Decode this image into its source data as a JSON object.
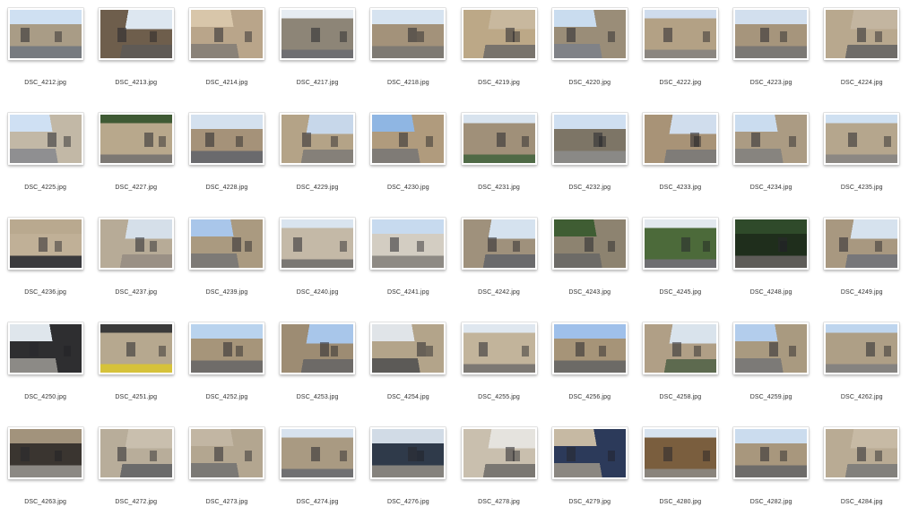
{
  "files": [
    {
      "name": "DSC_4212.jpg",
      "sky": "#cfe0f2",
      "wall": "#a99c86",
      "ground": "#777b80"
    },
    {
      "name": "DSC_4213.jpg",
      "sky": "#dde7f0",
      "wall": "#6e5e4c",
      "ground": "#5f5a55"
    },
    {
      "name": "DSC_4214.jpg",
      "sky": "#d8c6aa",
      "wall": "#b9a58a",
      "ground": "#8a8278"
    },
    {
      "name": "DSC_4217.jpg",
      "sky": "#e6ecf2",
      "wall": "#8d8577",
      "ground": "#6f6f72"
    },
    {
      "name": "DSC_4218.jpg",
      "sky": "#d6e3f0",
      "wall": "#a3927a",
      "ground": "#7e7a73"
    },
    {
      "name": "DSC_4219.jpg",
      "sky": "#c8b89e",
      "wall": "#bca887",
      "ground": "#78736c"
    },
    {
      "name": "DSC_4220.jpg",
      "sky": "#c9dcef",
      "wall": "#9a8d78",
      "ground": "#808287"
    },
    {
      "name": "DSC_4222.jpg",
      "sky": "#cfdced",
      "wall": "#b3a185",
      "ground": "#8b8680"
    },
    {
      "name": "DSC_4223.jpg",
      "sky": "#d2dfee",
      "wall": "#a6957c",
      "ground": "#7b7874"
    },
    {
      "name": "DSC_4224.jpg",
      "sky": "#c3b5a0",
      "wall": "#b8a88e",
      "ground": "#6f6c68"
    },
    {
      "name": "DSC_4225.jpg",
      "sky": "#cfe0f3",
      "wall": "#c2b8a6",
      "ground": "#8f8f91"
    },
    {
      "name": "DSC_4227.jpg",
      "sky": "#3f5a34",
      "wall": "#b8a88c",
      "ground": "#7c7873"
    },
    {
      "name": "DSC_4228.jpg",
      "sky": "#d4e1ef",
      "wall": "#a59279",
      "ground": "#6a6a6d"
    },
    {
      "name": "DSC_4229.jpg",
      "sky": "#c7d7ea",
      "wall": "#b4a387",
      "ground": "#858079"
    },
    {
      "name": "DSC_4230.jpg",
      "sky": "#8fb6e3",
      "wall": "#b09b7d",
      "ground": "#7f7b76"
    },
    {
      "name": "DSC_4231.jpg",
      "sky": "#d8e3ee",
      "wall": "#a09079",
      "ground": "#4f6a46"
    },
    {
      "name": "DSC_4232.jpg",
      "sky": "#cfdff1",
      "wall": "#7d7566",
      "ground": "#8a8986"
    },
    {
      "name": "DSC_4233.jpg",
      "sky": "#d0dded",
      "wall": "#a89377",
      "ground": "#7f7c78"
    },
    {
      "name": "DSC_4234.jpg",
      "sky": "#cadcef",
      "wall": "#ab9b83",
      "ground": "#87847f"
    },
    {
      "name": "DSC_4235.jpg",
      "sky": "#cfe0f1",
      "wall": "#b5a68d",
      "ground": "#8c8883"
    },
    {
      "name": "DSC_4236.jpg",
      "sky": "#b9a98f",
      "wall": "#c0b097",
      "ground": "#3a3a3d"
    },
    {
      "name": "DSC_4237.jpg",
      "sky": "#d5dfe9",
      "wall": "#b7ab97",
      "ground": "#9a9085"
    },
    {
      "name": "DSC_4239.jpg",
      "sky": "#a9c6ea",
      "wall": "#aa9a80",
      "ground": "#7d7a76"
    },
    {
      "name": "DSC_4240.jpg",
      "sky": "#d9e4ef",
      "wall": "#c4b9a7",
      "ground": "#7a7773"
    },
    {
      "name": "DSC_4241.jpg",
      "sky": "#c7daef",
      "wall": "#d3cdc2",
      "ground": "#8e8a84"
    },
    {
      "name": "DSC_4242.jpg",
      "sky": "#d5e2ef",
      "wall": "#9f917c",
      "ground": "#6a6a6c"
    },
    {
      "name": "DSC_4243.jpg",
      "sky": "#3f5d33",
      "wall": "#8d8370",
      "ground": "#6d6b67"
    },
    {
      "name": "DSC_4245.jpg",
      "sky": "#e2e8ee",
      "wall": "#4c6a3a",
      "ground": "#6e6e71"
    },
    {
      "name": "DSC_4248.jpg",
      "sky": "#2f4a2a",
      "wall": "#1f2e1c",
      "ground": "#5e5c58"
    },
    {
      "name": "DSC_4249.jpg",
      "sky": "#d6e2ee",
      "wall": "#a89880",
      "ground": "#77777a"
    },
    {
      "name": "DSC_4250.jpg",
      "sky": "#dfe6ec",
      "wall": "#2e2e30",
      "ground": "#8c8a86"
    },
    {
      "name": "DSC_4251.jpg",
      "sky": "#3a3a3a",
      "wall": "#b6a88f",
      "ground": "#d6c23a"
    },
    {
      "name": "DSC_4252.jpg",
      "sky": "#b9d3ee",
      "wall": "#a6957a",
      "ground": "#6f6c69"
    },
    {
      "name": "DSC_4253.jpg",
      "sky": "#a8c6ea",
      "wall": "#9d8c73",
      "ground": "#6d6a67"
    },
    {
      "name": "DSC_4254.jpg",
      "sky": "#e0e4e8",
      "wall": "#b3a48a",
      "ground": "#5c5a57"
    },
    {
      "name": "DSC_4255.jpg",
      "sky": "#dfe7ef",
      "wall": "#c2b49b",
      "ground": "#7c7873"
    },
    {
      "name": "DSC_4256.jpg",
      "sky": "#9fc0ea",
      "wall": "#a69478",
      "ground": "#6c6a66"
    },
    {
      "name": "DSC_4258.jpg",
      "sky": "#d9e3ec",
      "wall": "#b09f86",
      "ground": "#5d6a4f"
    },
    {
      "name": "DSC_4259.jpg",
      "sky": "#b3cdec",
      "wall": "#a99a80",
      "ground": "#7c7a77"
    },
    {
      "name": "DSC_4262.jpg",
      "sky": "#bed5ee",
      "wall": "#ae9f86",
      "ground": "#858380"
    },
    {
      "name": "DSC_4263.jpg",
      "sky": "#a2937c",
      "wall": "#3a3530",
      "ground": "#8c8984"
    },
    {
      "name": "DSC_4272.jpg",
      "sky": "#c9bfae",
      "wall": "#b8ad9a",
      "ground": "#6b6b6b"
    },
    {
      "name": "DSC_4273.jpg",
      "sky": "#c2b6a3",
      "wall": "#b3a690",
      "ground": "#7b7975"
    },
    {
      "name": "DSC_4274.jpg",
      "sky": "#d7e2ee",
      "wall": "#a99a82",
      "ground": "#707072"
    },
    {
      "name": "DSC_4276.jpg",
      "sky": "#d1dbe6",
      "wall": "#2f3a4a",
      "ground": "#85827d"
    },
    {
      "name": "DSC_4278.jpg",
      "sky": "#e5e3de",
      "wall": "#c9bfae",
      "ground": "#7a7772"
    },
    {
      "name": "DSC_4279.jpg",
      "sky": "#c6b9a3",
      "wall": "#2c3a5a",
      "ground": "#8b8781"
    },
    {
      "name": "DSC_4280.jpg",
      "sky": "#d7e3ef",
      "wall": "#7a5e3e",
      "ground": "#8a847c"
    },
    {
      "name": "DSC_4282.jpg",
      "sky": "#cbdcee",
      "wall": "#a8977d",
      "ground": "#6e6c6a"
    },
    {
      "name": "DSC_4284.jpg",
      "sky": "#c7baa5",
      "wall": "#b9ab94",
      "ground": "#82807c"
    }
  ]
}
